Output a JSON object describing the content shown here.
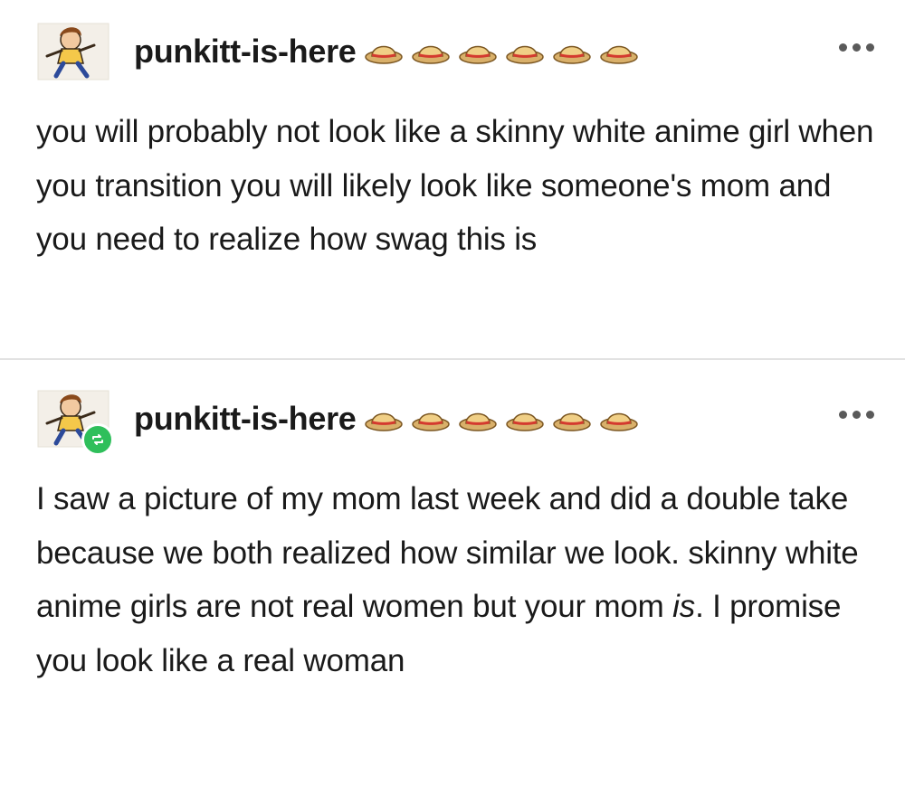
{
  "posts": [
    {
      "username": "punkitt-is-here",
      "badge_count": 6,
      "badge_icon": "straw-hat-emoji",
      "reblogged": false,
      "body": "you will probably not look like a skinny white anime girl when you transition you will likely look like someone's mom and you need to realize how swag this is"
    },
    {
      "username": "punkitt-is-here",
      "badge_count": 6,
      "badge_icon": "straw-hat-emoji",
      "reblogged": true,
      "body_before": "I saw a picture of my mom last week and did a double take because we both realized how similar we look. skinny white anime girls are not real women but your mom ",
      "body_emphasis": "is",
      "body_after": ". I promise you look like a real woman"
    }
  ],
  "colors": {
    "text": "#1a1a1a",
    "divider": "#e2e2e2",
    "reblog_badge": "#2fbf5b",
    "more_dots": "#5a5a5a"
  }
}
